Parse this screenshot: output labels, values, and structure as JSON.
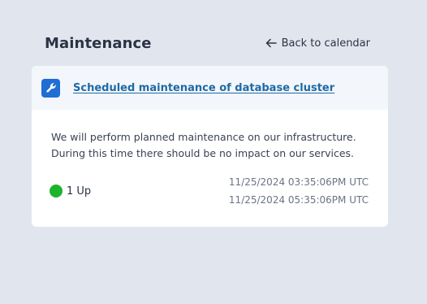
{
  "header": {
    "title": "Maintenance",
    "back_label": "Back to calendar"
  },
  "maintenance": {
    "title": "Scheduled maintenance of database cluster",
    "icon": "wrench-icon",
    "description_line1": "We will perform planned maintenance on our infrastructure.",
    "description_line2": "During this time there should be no impact on our services.",
    "status": {
      "label": "1 Up",
      "color": "#1db32c"
    },
    "start_time": "11/25/2024 03:35:06PM UTC",
    "end_time": "11/25/2024 05:35:06PM UTC"
  },
  "colors": {
    "background": "#e1e6ee",
    "accent": "#1f6ed4",
    "link": "#1e6aa5"
  }
}
